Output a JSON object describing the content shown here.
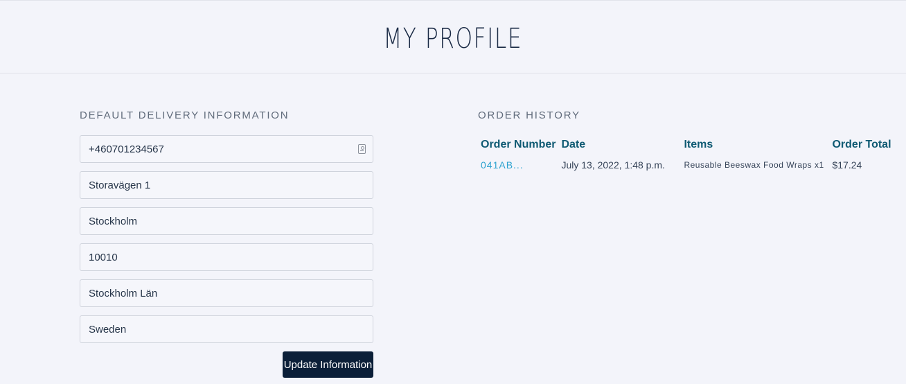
{
  "header": {
    "title": "MY PROFILE"
  },
  "delivery": {
    "heading": "DEFAULT DELIVERY INFORMATION",
    "fields": [
      {
        "value": "+460701234567",
        "icon": "contact-card-icon"
      },
      {
        "value": "Storavägen 1"
      },
      {
        "value": "Stockholm"
      },
      {
        "value": "10010"
      },
      {
        "value": "Stockholm Län"
      },
      {
        "value": "Sweden"
      }
    ],
    "button_label": "Update Information"
  },
  "order_history": {
    "heading": "ORDER HISTORY",
    "columns": [
      "Order Number",
      "Date",
      "Items",
      "Order Total"
    ],
    "rows": [
      {
        "order_number": "041AB...",
        "date": "July 13, 2022, 1:48 p.m.",
        "items": "Reusable Beeswax Food Wraps x1",
        "total": "$17.24"
      }
    ]
  },
  "colors": {
    "background": "#f3f4fa",
    "title": "#1a2a45",
    "heading": "#606b7b",
    "table_header": "#0f5a73",
    "link": "#2ba2cf",
    "button": "#0b1f38"
  }
}
